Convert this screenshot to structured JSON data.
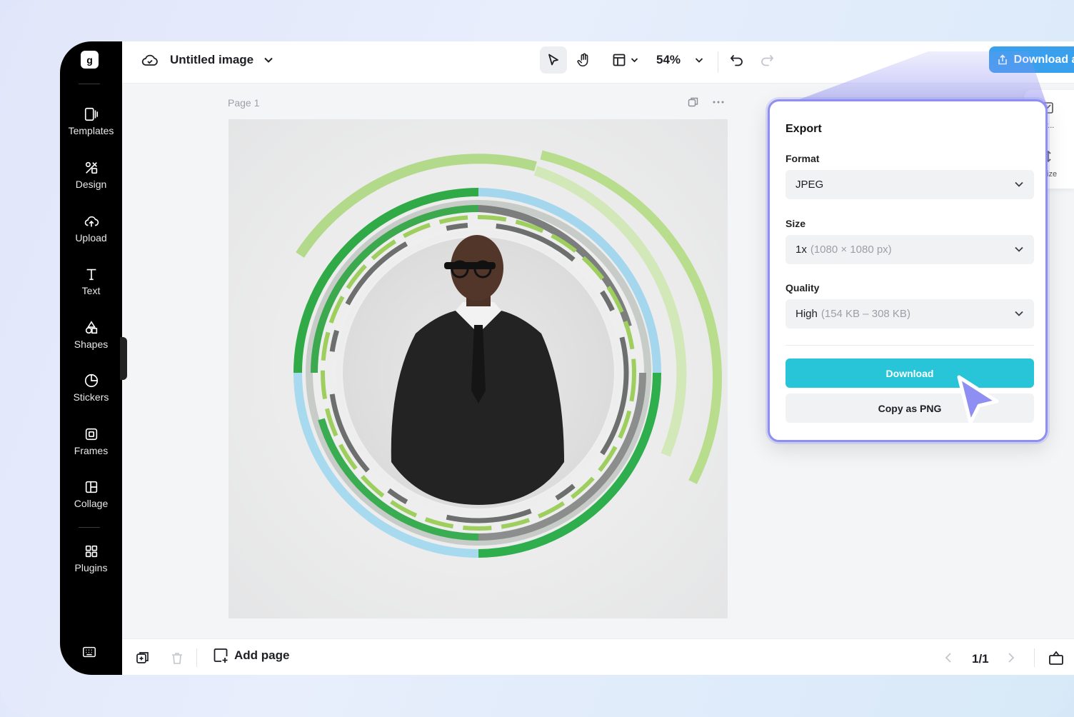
{
  "document": {
    "title": "Untitled image"
  },
  "sidebar": {
    "items": [
      {
        "label": "Templates",
        "icon": "templates-icon"
      },
      {
        "label": "Design",
        "icon": "design-icon"
      },
      {
        "label": "Upload",
        "icon": "upload-icon"
      },
      {
        "label": "Text",
        "icon": "text-icon"
      },
      {
        "label": "Shapes",
        "icon": "shapes-icon"
      },
      {
        "label": "Stickers",
        "icon": "stickers-icon"
      },
      {
        "label": "Frames",
        "icon": "frames-icon"
      },
      {
        "label": "Collage",
        "icon": "collage-icon"
      },
      {
        "label": "Plugins",
        "icon": "plugins-icon"
      }
    ]
  },
  "toolbar": {
    "zoom": "54%",
    "download_all_label": "Download all"
  },
  "canvas": {
    "page_label": "Page 1"
  },
  "bottom": {
    "add_page_label": "Add page",
    "pager": "1/1"
  },
  "side_panel": {
    "item1_fragment": "gr...",
    "item2_fragment": "ize"
  },
  "export": {
    "title": "Export",
    "format_label": "Format",
    "format_value": "JPEG",
    "size_label": "Size",
    "size_value": "1x",
    "size_detail": "(1080 × 1080 px)",
    "quality_label": "Quality",
    "quality_value": "High",
    "quality_detail": "(154 KB – 308 KB)",
    "download_label": "Download",
    "copy_label": "Copy as PNG"
  },
  "colors": {
    "accent": "#3aa0ee",
    "download_button": "#28c5d8",
    "popup_border": "#8f8ef3",
    "cursor": "#8f8ef3"
  }
}
